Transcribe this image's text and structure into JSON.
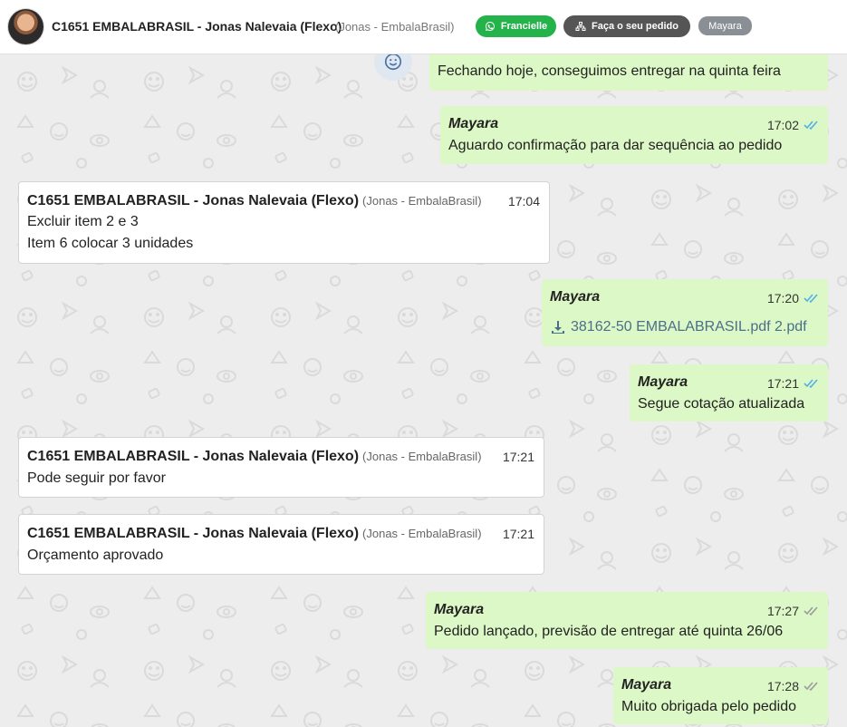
{
  "header": {
    "contact_name": "C1651 EMBALABRASIL - Jonas Nalevaia (Flexo)",
    "contact_sub": "(Jonas - EmbalaBrasil)",
    "pill_whatsapp": "Francielle",
    "pill_order": "Faça o seu pedido",
    "pill_agent": "Mayara"
  },
  "messages": {
    "m0": {
      "text": "Fechando hoje, conseguimos entregar na quinta feira"
    },
    "m1": {
      "author": "Mayara",
      "time": "17:02",
      "text": "Aguardo confirmação para dar sequência ao pedido"
    },
    "m2": {
      "author": "C1651 EMBALABRASIL - Jonas Nalevaia (Flexo)",
      "author_sub": "(Jonas - EmbalaBrasil)",
      "time": "17:04",
      "line1": "Excluir item 2 e 3",
      "line2": "Item 6 colocar 3 unidades"
    },
    "m3": {
      "author": "Mayara",
      "time": "17:20",
      "file": "38162-50 EMBALABRASIL.pdf 2.pdf"
    },
    "m4": {
      "author": "Mayara",
      "time": "17:21",
      "text": "Segue cotação atualizada"
    },
    "m5": {
      "author": "C1651 EMBALABRASIL - Jonas Nalevaia (Flexo)",
      "author_sub": "(Jonas - EmbalaBrasil)",
      "time": "17:21",
      "text": "Pode seguir por favor"
    },
    "m6": {
      "author": "C1651 EMBALABRASIL - Jonas Nalevaia (Flexo)",
      "author_sub": "(Jonas - EmbalaBrasil)",
      "time": "17:21",
      "text": "Orçamento aprovado"
    },
    "m7": {
      "author": "Mayara",
      "time": "17:27",
      "text": "Pedido lançado, previsão de entregar até quinta 26/06"
    },
    "m8": {
      "author": "Mayara",
      "time": "17:28",
      "text": "Muito obrigada pelo pedido"
    }
  },
  "colors": {
    "outgoing_bubble": "#dcf8c6",
    "incoming_bubble": "#ffffff",
    "read_check": "#4fb0e6",
    "delivered_check": "#9a9a9a",
    "whatsapp_pill": "#24b24a"
  },
  "icons": {
    "whatsapp": "whatsapp-icon",
    "order": "sitemap-icon",
    "emoji": "emoji-icon",
    "download": "download-icon",
    "read": "double-check-icon"
  }
}
